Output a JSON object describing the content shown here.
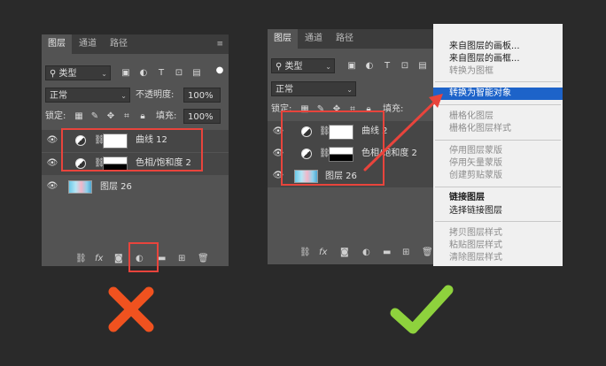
{
  "left_panel": {
    "tabs": [
      "图层",
      "通道",
      "路径"
    ],
    "filter_label": "类型",
    "blend_mode": "正常",
    "opacity_label": "不透明度:",
    "opacity_value": "100%",
    "lock_label": "锁定:",
    "fill_label": "填充:",
    "fill_value": "100%",
    "layers": [
      {
        "name": "曲线 12"
      },
      {
        "name": "色相/饱和度 2"
      },
      {
        "name": "图层 26"
      }
    ],
    "fx_label": "fx",
    "verdict_icon": "red-x-icon"
  },
  "right_panel": {
    "tabs": [
      "图层",
      "通道",
      "路径"
    ],
    "filter_label": "类型",
    "blend_mode": "正常",
    "lock_label": "锁定:",
    "fill_label": "填充:",
    "layers": [
      {
        "name": "曲线 2"
      },
      {
        "name": "色相/饱和度 2"
      },
      {
        "name": "图层 26"
      }
    ],
    "fx_label": "fx",
    "verdict_icon": "green-check-icon"
  },
  "context_menu": {
    "items": [
      {
        "label": "来自图层的画板...",
        "state": "normal"
      },
      {
        "label": "来自图层的画框...",
        "state": "normal"
      },
      {
        "label": "转换为图框",
        "state": "disabled"
      },
      {
        "label": "转换为智能对象",
        "state": "highlighted"
      },
      {
        "label": "栅格化图层",
        "state": "disabled"
      },
      {
        "label": "栅格化图层样式",
        "state": "disabled"
      },
      {
        "label": "停用图层蒙版",
        "state": "disabled"
      },
      {
        "label": "停用矢量蒙版",
        "state": "disabled"
      },
      {
        "label": "创建剪贴蒙版",
        "state": "disabled"
      },
      {
        "label": "链接图层",
        "state": "bold"
      },
      {
        "label": "选择链接图层",
        "state": "normal"
      },
      {
        "label": "拷贝图层样式",
        "state": "disabled"
      },
      {
        "label": "粘贴图层样式",
        "state": "disabled"
      },
      {
        "label": "清除图层样式",
        "state": "disabled"
      }
    ]
  },
  "colors": {
    "panel_bg": "#535353",
    "highlight_box": "#e8443c",
    "menu_highlight": "#1d63c9",
    "x_mark": "#f0521f",
    "check_mark": "#8ed23d"
  }
}
